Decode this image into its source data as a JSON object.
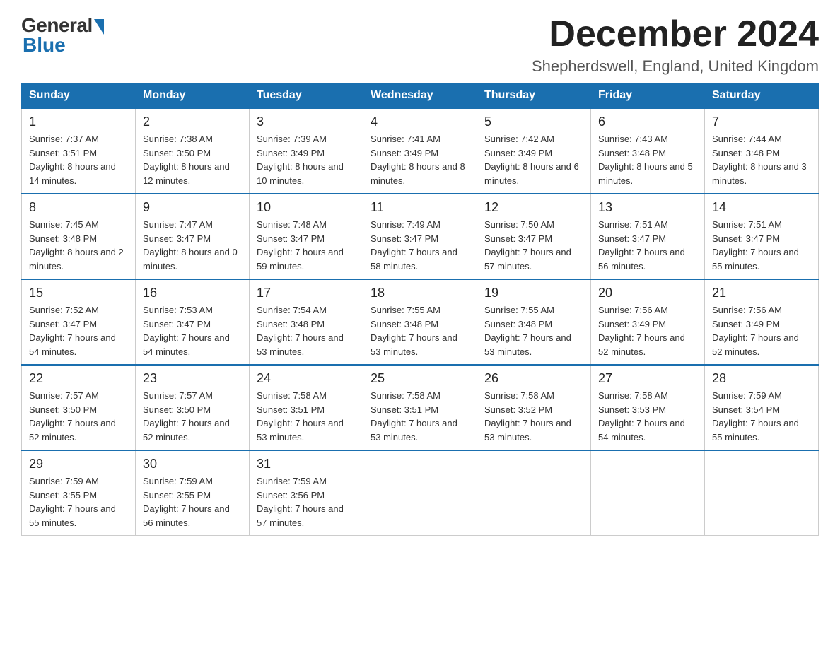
{
  "logo": {
    "general": "General",
    "blue": "Blue"
  },
  "header": {
    "month_title": "December 2024",
    "subtitle": "Shepherdswell, England, United Kingdom"
  },
  "days_of_week": [
    "Sunday",
    "Monday",
    "Tuesday",
    "Wednesday",
    "Thursday",
    "Friday",
    "Saturday"
  ],
  "weeks": [
    [
      {
        "day": "1",
        "sunrise": "7:37 AM",
        "sunset": "3:51 PM",
        "daylight": "8 hours and 14 minutes."
      },
      {
        "day": "2",
        "sunrise": "7:38 AM",
        "sunset": "3:50 PM",
        "daylight": "8 hours and 12 minutes."
      },
      {
        "day": "3",
        "sunrise": "7:39 AM",
        "sunset": "3:49 PM",
        "daylight": "8 hours and 10 minutes."
      },
      {
        "day": "4",
        "sunrise": "7:41 AM",
        "sunset": "3:49 PM",
        "daylight": "8 hours and 8 minutes."
      },
      {
        "day": "5",
        "sunrise": "7:42 AM",
        "sunset": "3:49 PM",
        "daylight": "8 hours and 6 minutes."
      },
      {
        "day": "6",
        "sunrise": "7:43 AM",
        "sunset": "3:48 PM",
        "daylight": "8 hours and 5 minutes."
      },
      {
        "day": "7",
        "sunrise": "7:44 AM",
        "sunset": "3:48 PM",
        "daylight": "8 hours and 3 minutes."
      }
    ],
    [
      {
        "day": "8",
        "sunrise": "7:45 AM",
        "sunset": "3:48 PM",
        "daylight": "8 hours and 2 minutes."
      },
      {
        "day": "9",
        "sunrise": "7:47 AM",
        "sunset": "3:47 PM",
        "daylight": "8 hours and 0 minutes."
      },
      {
        "day": "10",
        "sunrise": "7:48 AM",
        "sunset": "3:47 PM",
        "daylight": "7 hours and 59 minutes."
      },
      {
        "day": "11",
        "sunrise": "7:49 AM",
        "sunset": "3:47 PM",
        "daylight": "7 hours and 58 minutes."
      },
      {
        "day": "12",
        "sunrise": "7:50 AM",
        "sunset": "3:47 PM",
        "daylight": "7 hours and 57 minutes."
      },
      {
        "day": "13",
        "sunrise": "7:51 AM",
        "sunset": "3:47 PM",
        "daylight": "7 hours and 56 minutes."
      },
      {
        "day": "14",
        "sunrise": "7:51 AM",
        "sunset": "3:47 PM",
        "daylight": "7 hours and 55 minutes."
      }
    ],
    [
      {
        "day": "15",
        "sunrise": "7:52 AM",
        "sunset": "3:47 PM",
        "daylight": "7 hours and 54 minutes."
      },
      {
        "day": "16",
        "sunrise": "7:53 AM",
        "sunset": "3:47 PM",
        "daylight": "7 hours and 54 minutes."
      },
      {
        "day": "17",
        "sunrise": "7:54 AM",
        "sunset": "3:48 PM",
        "daylight": "7 hours and 53 minutes."
      },
      {
        "day": "18",
        "sunrise": "7:55 AM",
        "sunset": "3:48 PM",
        "daylight": "7 hours and 53 minutes."
      },
      {
        "day": "19",
        "sunrise": "7:55 AM",
        "sunset": "3:48 PM",
        "daylight": "7 hours and 53 minutes."
      },
      {
        "day": "20",
        "sunrise": "7:56 AM",
        "sunset": "3:49 PM",
        "daylight": "7 hours and 52 minutes."
      },
      {
        "day": "21",
        "sunrise": "7:56 AM",
        "sunset": "3:49 PM",
        "daylight": "7 hours and 52 minutes."
      }
    ],
    [
      {
        "day": "22",
        "sunrise": "7:57 AM",
        "sunset": "3:50 PM",
        "daylight": "7 hours and 52 minutes."
      },
      {
        "day": "23",
        "sunrise": "7:57 AM",
        "sunset": "3:50 PM",
        "daylight": "7 hours and 52 minutes."
      },
      {
        "day": "24",
        "sunrise": "7:58 AM",
        "sunset": "3:51 PM",
        "daylight": "7 hours and 53 minutes."
      },
      {
        "day": "25",
        "sunrise": "7:58 AM",
        "sunset": "3:51 PM",
        "daylight": "7 hours and 53 minutes."
      },
      {
        "day": "26",
        "sunrise": "7:58 AM",
        "sunset": "3:52 PM",
        "daylight": "7 hours and 53 minutes."
      },
      {
        "day": "27",
        "sunrise": "7:58 AM",
        "sunset": "3:53 PM",
        "daylight": "7 hours and 54 minutes."
      },
      {
        "day": "28",
        "sunrise": "7:59 AM",
        "sunset": "3:54 PM",
        "daylight": "7 hours and 55 minutes."
      }
    ],
    [
      {
        "day": "29",
        "sunrise": "7:59 AM",
        "sunset": "3:55 PM",
        "daylight": "7 hours and 55 minutes."
      },
      {
        "day": "30",
        "sunrise": "7:59 AM",
        "sunset": "3:55 PM",
        "daylight": "7 hours and 56 minutes."
      },
      {
        "day": "31",
        "sunrise": "7:59 AM",
        "sunset": "3:56 PM",
        "daylight": "7 hours and 57 minutes."
      },
      null,
      null,
      null,
      null
    ]
  ]
}
